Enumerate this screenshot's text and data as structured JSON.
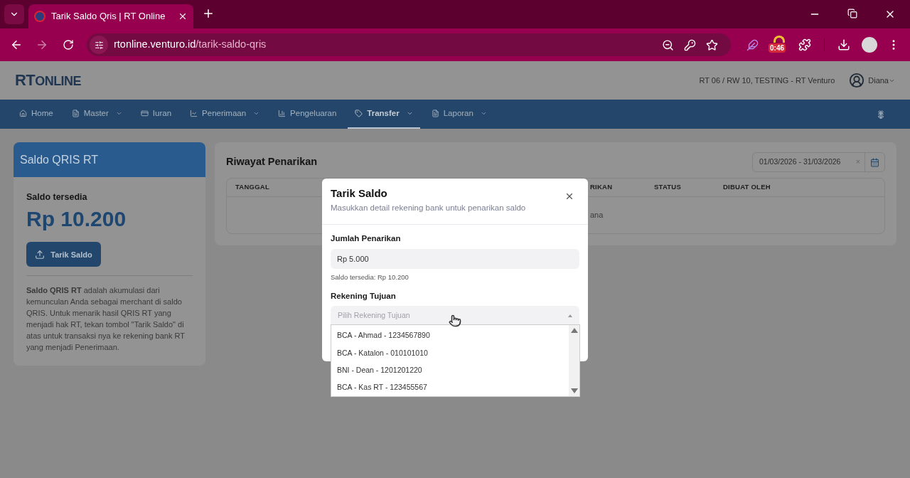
{
  "browser": {
    "tab_title": "Tarik Saldo Qris | RT Online",
    "url_host": "rtonline.venturo.id",
    "url_path": "/tarik-saldo-qris",
    "extension_badge": "0:46"
  },
  "header": {
    "logo_main": "RT",
    "logo_tail": "ONLINE",
    "org": "RT 06 / RW 10, TESTING - RT Venturo",
    "user": "Diana"
  },
  "nav": [
    {
      "label": "Home",
      "dropdown": false,
      "selected": false
    },
    {
      "label": "Master",
      "dropdown": true,
      "selected": false
    },
    {
      "label": "Iuran",
      "dropdown": false,
      "selected": false
    },
    {
      "label": "Penerimaan",
      "dropdown": true,
      "selected": false
    },
    {
      "label": "Pengeluaran",
      "dropdown": false,
      "selected": false
    },
    {
      "label": "Transfer",
      "dropdown": true,
      "selected": true
    },
    {
      "label": "Laporan",
      "dropdown": true,
      "selected": false
    }
  ],
  "saldo_card": {
    "title": "Saldo QRIS RT",
    "label": "Saldo tersedia",
    "amount": "Rp 10.200",
    "button": "Tarik Saldo",
    "description": "**Saldo QRIS RT** adalah akumulasi dari kemunculan Anda sebagai merchant di saldo QRIS. Untuk menarik hasil QRIS RT yang menjadi hak RT, tekan tombol \"Tarik Saldo\" di atas untuk transaksi nya ke rekening bank RT yang menjadi Penerimaan."
  },
  "history": {
    "title": "Riwayat Penarikan",
    "date_range": "01/03/2026 - 31/03/2026",
    "clear": "×",
    "columns": [
      "TANGGAL",
      "RIKAN",
      "STATUS",
      "DIBUAT OLEH"
    ],
    "empty_text": "ana"
  },
  "modal": {
    "title": "Tarik Saldo",
    "subtitle": "Masukkan detail rekening bank untuk penarikan saldo",
    "amount_label": "Jumlah Penarikan",
    "amount_value": "Rp 5.000",
    "amount_hint": "Saldo tersedia: Rp 10.200",
    "account_label": "Rekening Tujuan",
    "account_placeholder": "Pilih Rekening Tujuan",
    "options": [
      "BCA - Ahmad - 1234567890",
      "BCA - Katalon - 010101010",
      "BNI - Dean - 1201201220",
      "BCA - Kas RT - 123455567"
    ]
  }
}
